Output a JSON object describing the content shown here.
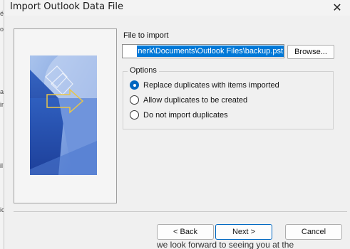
{
  "background": {
    "left_fragments": [
      "ëd",
      "or",
      "as",
      "in",
      "il",
      "ic"
    ],
    "bottom_text": "we look forward to seeing you at the"
  },
  "dialog": {
    "title": "Import Outlook Data File",
    "close_icon": "close-icon"
  },
  "file_section": {
    "label": "File to import",
    "path_value": "nerk\\Documents\\Outlook Files\\backup.pst",
    "browse_label": "Browse..."
  },
  "options": {
    "legend": "Options",
    "choices": [
      {
        "label": "Replace duplicates with items imported",
        "checked": true
      },
      {
        "label": "Allow duplicates to be created",
        "checked": false
      },
      {
        "label": "Do not import duplicates",
        "checked": false
      }
    ]
  },
  "buttons": {
    "back": "< Back",
    "next": "Next >",
    "cancel": "Cancel"
  },
  "colors": {
    "accent": "#0067c0",
    "selection": "#0078d7"
  }
}
